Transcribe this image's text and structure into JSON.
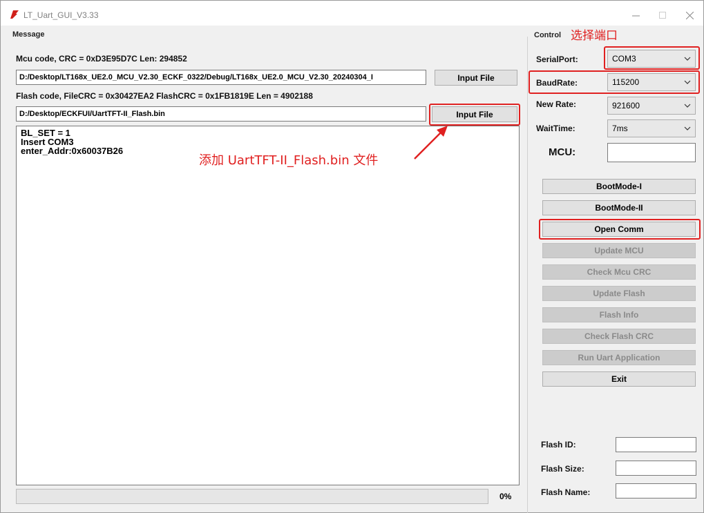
{
  "window": {
    "title": "LT_Uart_GUI_V3.33"
  },
  "message": {
    "group_label": "Message",
    "mcu_code_label": "Mcu code, CRC = 0xD3E95D7C Len: 294852",
    "mcu_path": "D:/Desktop/LT168x_UE2.0_MCU_V2.30_ECKF_0322/Debug/LT168x_UE2.0_MCU_V2.30_20240304_I",
    "input_file_label": "Input File",
    "flash_code_label": "Flash code, FileCRC = 0x30427EA2  FlashCRC = 0x1FB1819E  Len = 4902188",
    "flash_path": "D:/Desktop/ECKFUI/UartTFT-II_Flash.bin",
    "log_lines": [
      "BL_SET = 1",
      "Insert COM3",
      "enter_Addr:0x60037B26"
    ],
    "progress_percent": 0,
    "progress_label": "0%"
  },
  "control": {
    "group_label": "Control",
    "serial_port_label": "SerialPort:",
    "serial_port_value": "COM3",
    "baud_rate_label": "BaudRate:",
    "baud_rate_value": "115200",
    "new_rate_label": "New Rate:",
    "new_rate_value": "921600",
    "wait_time_label": "WaitTime:",
    "wait_time_value": "7ms",
    "mcu_label": "MCU:",
    "mcu_value": "",
    "buttons": {
      "bootmode1": "BootMode-I",
      "bootmode2": "BootMode-II",
      "open_comm": "Open Comm",
      "update_mcu": "Update MCU",
      "check_mcu_crc": "Check Mcu CRC",
      "update_flash": "Update Flash",
      "flash_info": "Flash Info",
      "check_flash_crc": "Check Flash CRC",
      "run_uart_app": "Run Uart Application",
      "exit": "Exit"
    },
    "flash_id_label": "Flash ID:",
    "flash_size_label": "Flash Size:",
    "flash_name_label": "Flash Name:"
  },
  "annotations": {
    "select_port": "选择端口",
    "add_file": "添加 UartTFT-II_Flash.bin 文件"
  },
  "colors": {
    "highlight": "#e02020",
    "app_icon": "#d0201a"
  }
}
